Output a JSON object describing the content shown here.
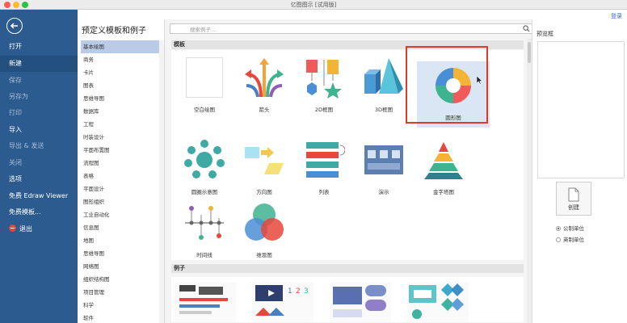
{
  "window": {
    "title": "亿图图示 [试用版]",
    "login": "登录"
  },
  "sidebar": {
    "items": [
      {
        "label": "打开",
        "style": "normal"
      },
      {
        "label": "新建",
        "style": "active"
      },
      {
        "label": "保存",
        "style": "dim"
      },
      {
        "label": "另存为",
        "style": "dim"
      },
      {
        "label": "打印",
        "style": "dim"
      },
      {
        "label": "导入",
        "style": "normal"
      },
      {
        "label": "导出 & 发送",
        "style": "dim"
      },
      {
        "label": "关闭",
        "style": "dim"
      },
      {
        "label": "选项",
        "style": "normal"
      },
      {
        "label": "免费 Edraw Viewer",
        "style": "normal"
      },
      {
        "label": "免费模板...",
        "style": "normal"
      },
      {
        "label": "退出",
        "style": "normal"
      }
    ]
  },
  "categories": {
    "title": "预定义模板和例子",
    "items": [
      "基本绘图",
      "商务",
      "卡片",
      "图表",
      "思维导图",
      "数据库",
      "工程",
      "时装设计",
      "平面布置图",
      "流程图",
      "表格",
      "平面设计",
      "图形组织",
      "工业自动化",
      "信息图",
      "地图",
      "思维导图",
      "网络图",
      "组织结构图",
      "项目管理",
      "科学",
      "软件"
    ]
  },
  "gallery": {
    "search_placeholder": "搜索例子...",
    "templates_header": "模板",
    "examples_header": "例子",
    "tiles": [
      {
        "label": "空白绘图"
      },
      {
        "label": "箭头"
      },
      {
        "label": "2D框图"
      },
      {
        "label": "3D框图"
      },
      {
        "label": "圆形图"
      },
      {
        "label": "圆圈示意图"
      },
      {
        "label": "方向图"
      },
      {
        "label": "列表"
      },
      {
        "label": "演示"
      },
      {
        "label": "金字塔图"
      },
      {
        "label": "时间线"
      },
      {
        "label": "维恩图"
      }
    ]
  },
  "preview": {
    "title": "预览框",
    "create_label": "创建",
    "unit_options": [
      {
        "label": "公制单位",
        "selected": true
      },
      {
        "label": "英制单位",
        "selected": false
      }
    ]
  },
  "colors": {
    "sidebar": "#2b5b8f",
    "accent": "#2f6bbd",
    "highlight": "#e0392a"
  }
}
